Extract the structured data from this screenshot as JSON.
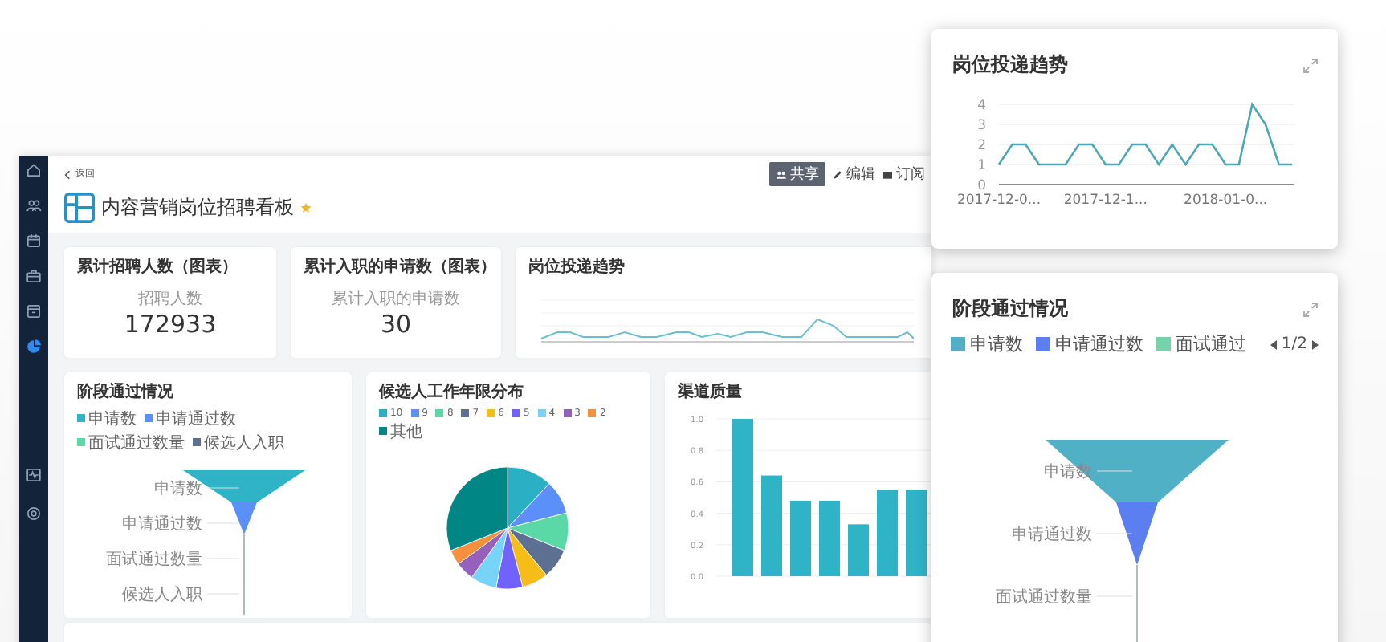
{
  "sidebar": {
    "top_items": [
      {
        "kind": "home",
        "selected": false
      },
      {
        "kind": "people",
        "selected": false
      },
      {
        "kind": "calendar",
        "selected": false
      },
      {
        "kind": "briefcase",
        "selected": false
      },
      {
        "kind": "archive",
        "selected": false
      },
      {
        "kind": "chart",
        "selected": true
      }
    ],
    "bottom_items": [
      {
        "kind": "pulse",
        "selected": false
      },
      {
        "kind": "settings",
        "selected": false
      }
    ]
  },
  "header": {
    "back": "返回",
    "actions": [
      {
        "kind": "share",
        "label": "共享"
      },
      {
        "kind": "edit",
        "label": "编辑"
      },
      {
        "kind": "subscribe",
        "label": "订阅"
      }
    ],
    "title": "内容营销岗位招聘看板",
    "starred": true
  },
  "stat_cards": [
    {
      "title": "累计招聘人数（图表）",
      "label": "招聘人数",
      "value": "172933"
    },
    {
      "title": "累计入职的申请数（图表）",
      "label": "累计入职的申请数",
      "value": "30"
    }
  ],
  "trend_card": {
    "title": "岗位投递趋势"
  },
  "funnel_card": {
    "title": "阶段通过情况",
    "legend": [
      {
        "label": "申请数",
        "color": "#2fb3c7"
      },
      {
        "label": "申请通过数",
        "color": "#5b8ff9"
      },
      {
        "label": "面试通过数量",
        "color": "#5ad8a6"
      },
      {
        "label": "候选人入职",
        "color": "#5d7092"
      }
    ],
    "stage_labels": [
      "申请数",
      "申请通过数",
      "面试通过数量",
      "候选人入职"
    ]
  },
  "pie_card": {
    "title": "候选人工作年限分布",
    "legend": [
      {
        "label": "10",
        "color": "#2ab0c5"
      },
      {
        "label": "9",
        "color": "#5b8ff9"
      },
      {
        "label": "8",
        "color": "#5ad8a6"
      },
      {
        "label": "7",
        "color": "#5d7092"
      },
      {
        "label": "6",
        "color": "#f6bd16"
      },
      {
        "label": "5",
        "color": "#7262fd"
      },
      {
        "label": "4",
        "color": "#78d3f8"
      },
      {
        "label": "3",
        "color": "#9661bc"
      },
      {
        "label": "2",
        "color": "#f6903d"
      },
      {
        "label": "其他",
        "color": "#008685"
      }
    ]
  },
  "bar_card": {
    "title": "渠道质量",
    "chart_data": {
      "type": "bar",
      "grid": true,
      "values": [
        1.0,
        0.64,
        0.48,
        0.48,
        0.33,
        0.55,
        0.55
      ],
      "ylim": [
        0,
        1
      ],
      "yticks": [
        {
          "value": 0,
          "label": "0.0"
        },
        {
          "value": 0.2,
          "label": "0.2"
        },
        {
          "value": 0.4,
          "label": "0.4"
        },
        {
          "value": 0.6,
          "label": "0.6"
        },
        {
          "value": 0.8,
          "label": "0.8"
        },
        {
          "value": 1,
          "label": "1.0"
        }
      ]
    }
  },
  "overlay_trend": {
    "title": "岗位投递趋势",
    "chart_data": {
      "type": "line",
      "grid": true,
      "categories": [
        "2017-12-0...",
        null,
        null,
        null,
        null,
        null,
        null,
        null,
        "2017-12-1...",
        null,
        null,
        null,
        null,
        null,
        null,
        null,
        null,
        "2018-01-0...",
        null,
        null,
        null,
        null,
        null
      ],
      "series": [
        {
          "color": "#4ca8b4",
          "values": [
            1,
            2,
            2,
            1,
            1,
            1,
            2,
            2,
            1,
            1,
            2,
            2,
            1,
            2,
            1,
            2,
            2,
            1,
            1,
            4,
            3,
            1,
            1
          ]
        }
      ],
      "ylim": [
        0,
        4
      ],
      "yticks": [
        0,
        1,
        2,
        3,
        4
      ]
    }
  },
  "overlay_funnel": {
    "title": "阶段通过情况",
    "legend": [
      {
        "label": "申请数",
        "color": "#4fb0c6"
      },
      {
        "label": "申请通过数",
        "color": "#5b7ff0"
      },
      {
        "label": "面试通过",
        "color": "#74d3a8"
      }
    ],
    "pager": "1/2",
    "stage_labels": [
      "申请数",
      "申请通过数",
      "面试通过数量"
    ]
  }
}
